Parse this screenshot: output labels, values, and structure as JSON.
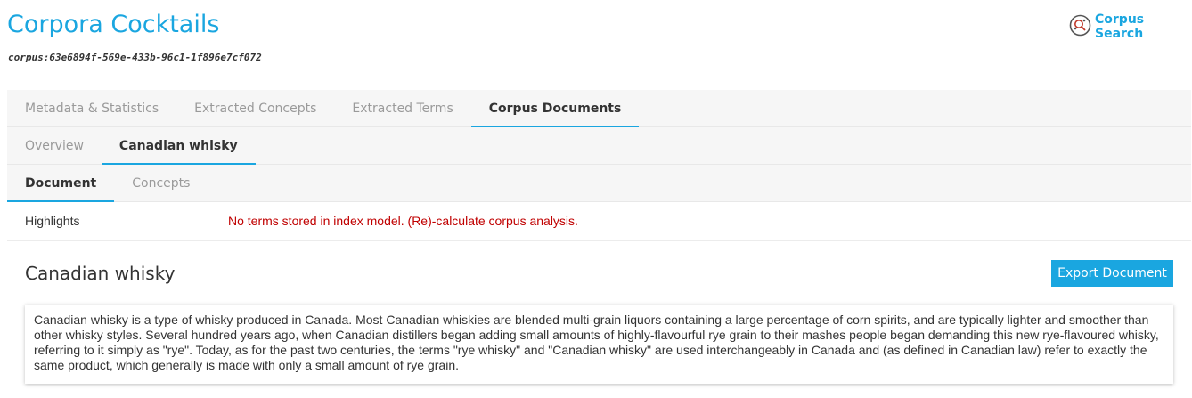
{
  "header": {
    "title": "Corpora Cocktails",
    "corpus_id": "corpus:63e6894f-569e-433b-96c1-1f896e7cf072",
    "search_label": "Corpus Search"
  },
  "tabs_main": [
    {
      "label": "Metadata & Statistics",
      "active": false
    },
    {
      "label": "Extracted Concepts",
      "active": false
    },
    {
      "label": "Extracted Terms",
      "active": false
    },
    {
      "label": "Corpus Documents",
      "active": true
    }
  ],
  "tabs_docs": [
    {
      "label": "Overview",
      "active": false
    },
    {
      "label": "Canadian whisky",
      "active": true
    }
  ],
  "tabs_view": [
    {
      "label": "Document",
      "active": true
    },
    {
      "label": "Concepts",
      "active": false
    }
  ],
  "highlights": {
    "label": "Highlights",
    "message": "No terms stored in index model. (Re)-calculate corpus analysis."
  },
  "document": {
    "title": "Canadian whisky",
    "export_label": "Export Document",
    "text": "Canadian whisky is a type of whisky produced in Canada. Most Canadian whiskies are blended multi-grain liquors containing a large percentage of corn spirits, and are typically lighter and smoother than other whisky styles. Several hundred years ago, when Canadian distillers began adding small amounts of highly-flavourful rye grain to their mashes people began demanding this new rye-flavoured whisky, referring to it simply as \"rye\". Today, as for the past two centuries, the terms \"rye whisky\" and \"Canadian whisky\" are used interchangeably in Canada and (as defined in Canadian law) refer to exactly the same product, which generally is made with only a small amount of rye grain."
  },
  "colors": {
    "accent": "#1aa6e0",
    "error": "#c00000",
    "tab_bg": "#f6f6f6"
  }
}
